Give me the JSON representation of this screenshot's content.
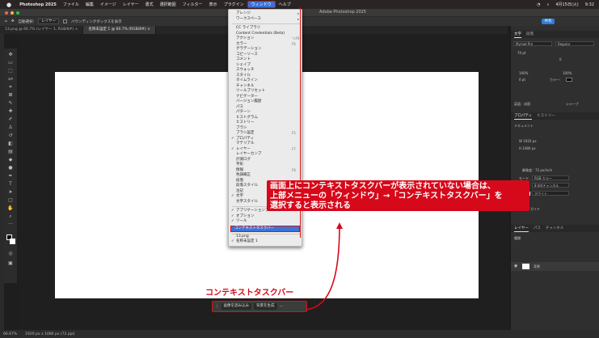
{
  "menubar": {
    "app": "Photoshop 2025",
    "items": [
      "ファイル",
      "編集",
      "イメージ",
      "レイヤー",
      "書式",
      "選択範囲",
      "フィルター",
      "表示",
      "プラグイン",
      "ウィンドウ",
      "ヘルプ"
    ],
    "active": "ウィンドウ",
    "status_right": [
      "4月15日(火)",
      "9:32"
    ]
  },
  "app_title": "Adobe Photoshop 2025",
  "options_bar": {
    "auto_select_label": "自動選択:",
    "auto_select_value": "レイヤー",
    "bounding_box_label": "バウンディングボックスを表示"
  },
  "share_label": "共有",
  "tabs": [
    {
      "label": "13.png @ 66.7% (レイヤー 1, RGB/8#) ×"
    },
    {
      "label": "名称未設定 1 @ 66.7% (RGB/8#) ×"
    }
  ],
  "window_menu": {
    "items": [
      {
        "label": "アレンジ",
        "arrow": true
      },
      {
        "label": "ワークスペース",
        "arrow": true
      },
      {
        "label": "",
        "sep": true
      },
      {
        "label": "CC ライブラリ"
      },
      {
        "label": "Content Credentials (Beta)"
      },
      {
        "label": "アクション",
        "shortcut": "⌥F9"
      },
      {
        "label": "カラー",
        "shortcut": "F6"
      },
      {
        "label": "グラデーション"
      },
      {
        "label": "コピーソース"
      },
      {
        "label": "コメント"
      },
      {
        "label": "シェイプ"
      },
      {
        "label": "スウォッチ"
      },
      {
        "label": "スタイル"
      },
      {
        "label": "タイムライン"
      },
      {
        "label": "チャンネル"
      },
      {
        "label": "ツールプリセット"
      },
      {
        "label": "ナビゲーター"
      },
      {
        "label": "バージョン履歴"
      },
      {
        "label": "パス"
      },
      {
        "label": "パターン"
      },
      {
        "label": "ヒストグラム"
      },
      {
        "label": "ヒストリー"
      },
      {
        "label": "ブラシ"
      },
      {
        "label": "ブラシ設定",
        "shortcut": "F5"
      },
      {
        "label": "プロパティ",
        "check": true
      },
      {
        "label": "マテリアル"
      },
      {
        "label": "レイヤー",
        "check": true,
        "shortcut": "F7"
      },
      {
        "label": "レイヤーカンプ"
      },
      {
        "label": "計測ログ"
      },
      {
        "label": "字形"
      },
      {
        "label": "情報",
        "shortcut": "F8"
      },
      {
        "label": "色調補正"
      },
      {
        "label": "段落"
      },
      {
        "label": "段落スタイル"
      },
      {
        "label": "注記"
      },
      {
        "label": "文字",
        "check": true
      },
      {
        "label": "文字スタイル"
      },
      {
        "label": "",
        "sep": true
      },
      {
        "label": "アプリケーションフレーム",
        "check": true
      },
      {
        "label": "オプション",
        "check": true
      },
      {
        "label": "ツール",
        "check": true
      }
    ],
    "highlighted": "コンテキストタスクバー",
    "docs": [
      {
        "label": "13.png"
      },
      {
        "label": "名称未設定 1",
        "check": true
      }
    ]
  },
  "callout": {
    "line1": "画面上にコンテキストタスクバーが表示されていない場合は、",
    "line2": "上部メニューの「ウィンドウ」→「コンテキストタスクバー」を",
    "line3": "選択すると表示される"
  },
  "context_label": "コンテキストタスクバー",
  "context_taskbar": {
    "btn1": "画像を読み込み",
    "btn2": "背景を生成",
    "more": "···"
  },
  "statusbar": {
    "zoom": "66.67%",
    "size": "1920 px x 1080 px (72 ppi)"
  },
  "right_panel": {
    "char_tabs": [
      "文字",
      "段落"
    ],
    "font": "Myriad Pro",
    "style": "Regular",
    "size": "70 pt",
    "tracking": "0",
    "scale_v": "100%",
    "scale_h": "100%",
    "baseline": "0 pt",
    "color_label": "カラー:",
    "lang": "英語：米国",
    "aa": "シャープ",
    "prop_tabs": [
      "プロパティ",
      "ヒストリー"
    ],
    "doc_label": "ドキュメント",
    "w": "W  1920 px",
    "h": "H  1080 px",
    "res": "解像度：72 px/inch",
    "mode_label": "モード",
    "mode": "RGB カラー",
    "bits": "8 bit/チャンネル",
    "fill": "ホワイト",
    "guide": "ガイド",
    "layer_tabs": [
      "レイヤー",
      "パス",
      "チャンネル"
    ],
    "kind": "種類",
    "layer_name": "背景"
  }
}
